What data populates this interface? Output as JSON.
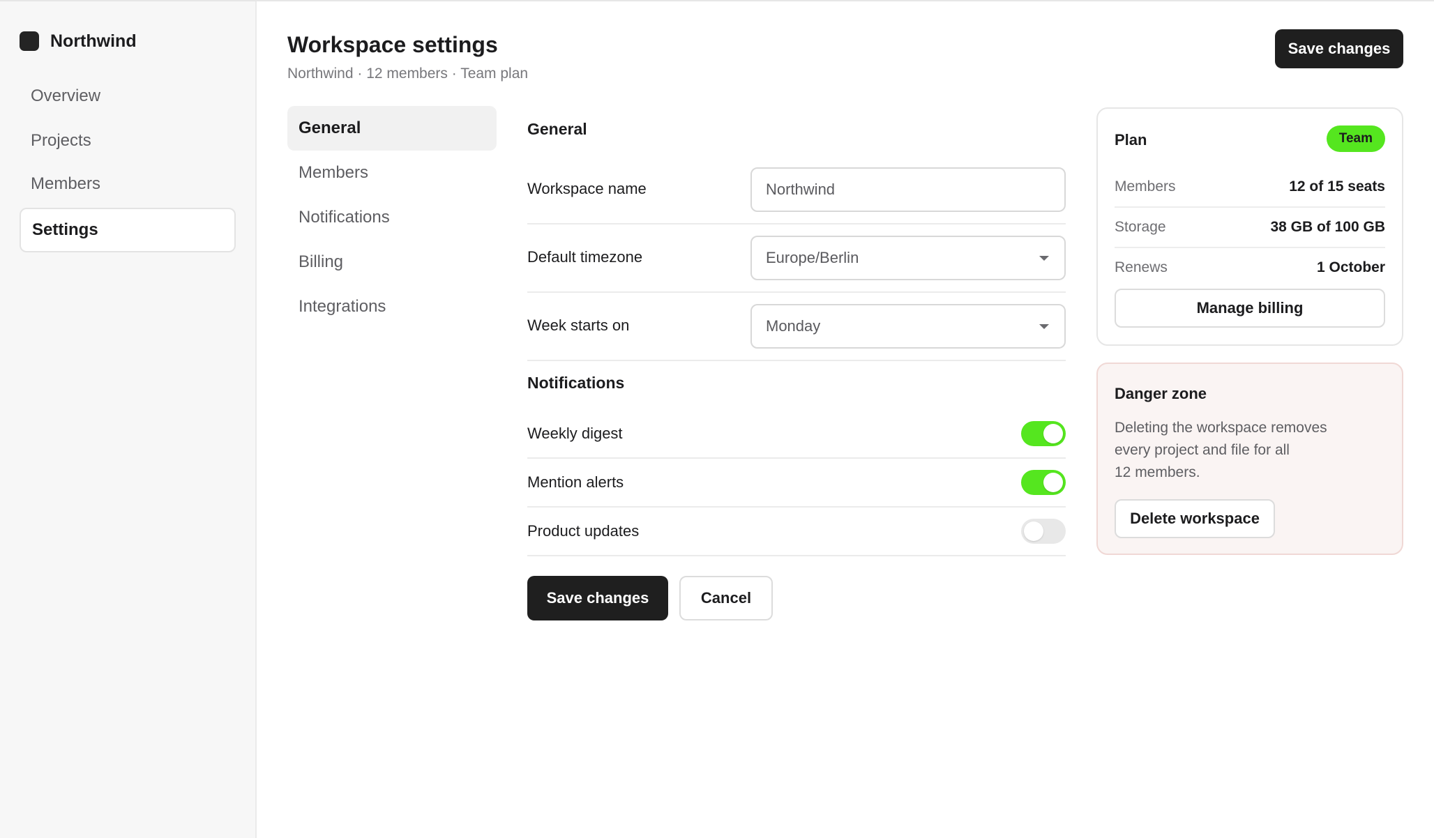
{
  "brand": {
    "name": "Northwind"
  },
  "sidebar": {
    "items": [
      {
        "label": "Overview"
      },
      {
        "label": "Projects"
      },
      {
        "label": "Members"
      },
      {
        "label": "Settings"
      }
    ],
    "active": "Settings"
  },
  "header": {
    "title": "Workspace settings",
    "subtitle": "Northwind · 12 members · Team plan",
    "save_label": "Save changes"
  },
  "sections": {
    "items": [
      {
        "label": "General"
      },
      {
        "label": "Members"
      },
      {
        "label": "Notifications"
      },
      {
        "label": "Billing"
      },
      {
        "label": "Integrations"
      }
    ],
    "active": "General"
  },
  "form": {
    "general_heading": "General",
    "workspace_name": {
      "label": "Workspace name",
      "value": "Northwind"
    },
    "timezone": {
      "label": "Default timezone",
      "value": "Europe/Berlin"
    },
    "week_start": {
      "label": "Week starts on",
      "value": "Monday"
    },
    "notifications_heading": "Notifications",
    "toggles": [
      {
        "label": "Weekly digest",
        "on": true
      },
      {
        "label": "Mention alerts",
        "on": true
      },
      {
        "label": "Product updates",
        "on": false
      }
    ],
    "save_label": "Save changes",
    "cancel_label": "Cancel"
  },
  "plan_card": {
    "title": "Plan",
    "badge": "Team",
    "rows": [
      {
        "label": "Members",
        "value": "12 of 15 seats"
      },
      {
        "label": "Storage",
        "value": "38 GB of 100 GB"
      },
      {
        "label": "Renews",
        "value": "1 October"
      }
    ],
    "button_label": "Manage billing"
  },
  "danger_card": {
    "title": "Danger zone",
    "lines": [
      "Deleting the workspace removes",
      "every project and file for all",
      "12 members."
    ],
    "button_label": "Delete workspace"
  },
  "colors": {
    "accent": "#55e61f",
    "primary_button": "#1f1f1f",
    "danger_background": "#faf4f3"
  },
  "icons": {
    "brand": "square-logo-icon",
    "select": "chevron-down-icon"
  }
}
